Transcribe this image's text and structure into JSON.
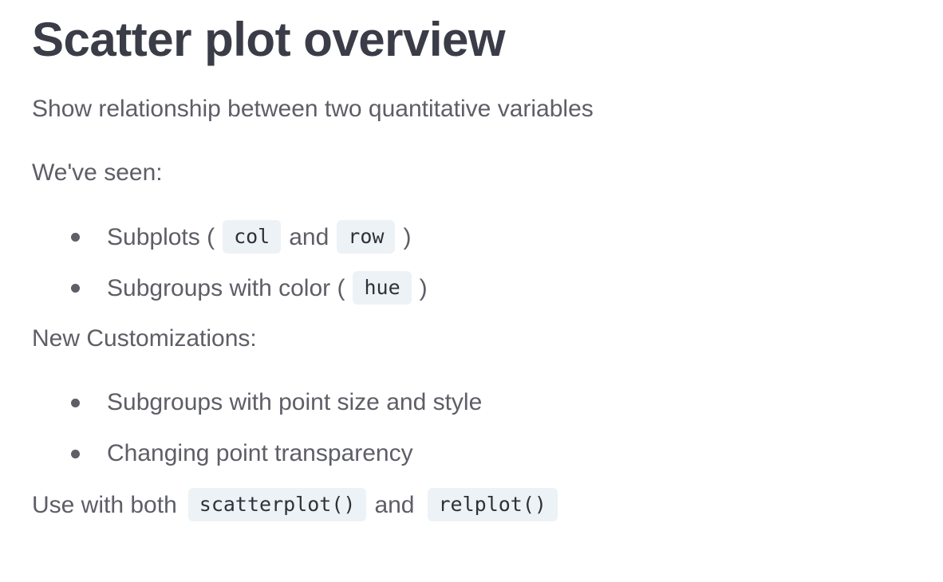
{
  "title": "Scatter plot overview",
  "intro": "Show relationship between two quantitative variables",
  "seen_heading": "We've seen:",
  "seen": {
    "item1": {
      "before": "Subplots (",
      "code1": "col",
      "middle": "and",
      "code2": "row",
      "after": ")"
    },
    "item2": {
      "before": "Subgroups with color (",
      "code": "hue",
      "after": ")"
    }
  },
  "new_heading": "New Customizations:",
  "new_items": [
    "Subgroups with point size and style",
    "Changing point transparency"
  ],
  "usage": {
    "before": "Use with both",
    "code1": "scatterplot()",
    "middle": "and",
    "code2": "relplot()"
  },
  "colors": {
    "title": "#3a3c47",
    "text": "#5d5e66",
    "code_background": "#edf2f6",
    "code_text": "#2e3139"
  }
}
